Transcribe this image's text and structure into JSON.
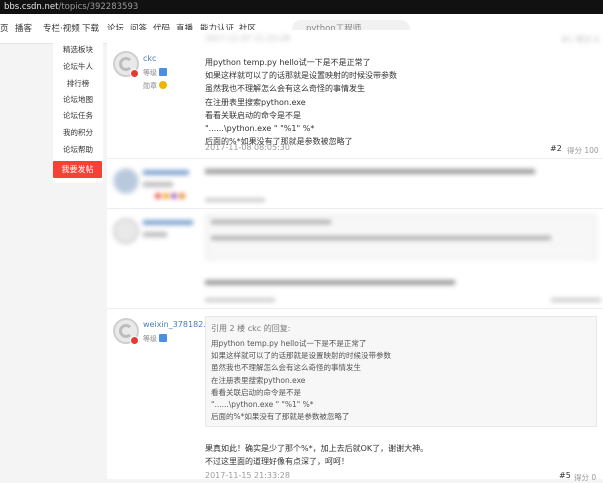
{
  "browser": {
    "domain": "bbs.csdn.net",
    "path": "/topics/392283593"
  },
  "nav": {
    "items": [
      "页",
      "播客",
      "专栏·视频",
      "下载",
      "论坛",
      "问答",
      "代码",
      "直播",
      "能力认证",
      "社区"
    ],
    "search_placeholder": "python工程师"
  },
  "sidebar": {
    "items": [
      "精选板块",
      "论坛牛人",
      "排行榜",
      "论坛地图",
      "论坛任务",
      "我的积分",
      "论坛帮助"
    ],
    "post_button": "我要发帖"
  },
  "posts": [
    {
      "user": "ckc",
      "level_label": "等级",
      "medal_label": "勋章",
      "lines": [
        "用python temp.py hello试一下是不是正常了",
        "如果这样就可以了的话那就是设置映射的时候没带参数",
        "虽然我也不理解怎么会有这么奇怪的事情发生",
        "在注册表里搜索python.exe",
        "看看关联启动的命令是不是",
        "\"......\\python.exe \" \"%1\" %*",
        "后面的%*如果没有了那就是参数被忽略了"
      ],
      "timestamp": "2017-11-08 08:05:30",
      "floor": "#2",
      "score": "得分 100"
    },
    {
      "user": "weixin_378182...",
      "level_label": "等级",
      "quote_title": "引用 2 楼 ckc 的回复:",
      "quote_lines": [
        "用python temp.py hello试一下是不是正常了",
        "如果这样就可以了的话那就是设置映射的时候没带参数",
        "虽然我也不理解怎么会有这么奇怪的事情发生",
        "在注册表里搜索python.exe",
        "看看关联启动的命令是不是",
        "\"......\\python.exe \" \"%1\" %*",
        "后面的%*如果没有了那就是参数被忽略了"
      ],
      "reply_lines": [
        "果真如此！确实是少了那个%*，加上去后就OK了，谢谢大神。",
        "不过这里面的道理好像有点深了，呵呵！"
      ],
      "timestamp": "2017-11-15 21:33:28",
      "floor": "#5",
      "score": "得分 0"
    }
  ]
}
